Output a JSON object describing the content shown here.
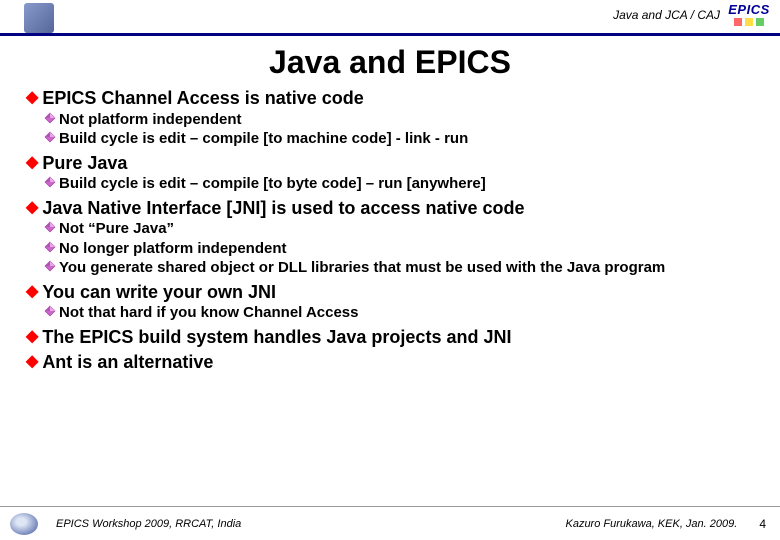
{
  "header": {
    "path": "Java and JCA / CAJ",
    "logo_text": "EPICS"
  },
  "title": "Java and EPICS",
  "bullets": [
    {
      "level": 1,
      "text": "EPICS Channel Access is native code"
    },
    {
      "level": 2,
      "text": "Not platform independent"
    },
    {
      "level": 2,
      "text": "Build cycle is edit – compile [to machine code] - link - run"
    },
    {
      "level": 1,
      "text": "Pure Java"
    },
    {
      "level": 2,
      "text": "Build cycle is edit – compile [to byte code] – run [anywhere]"
    },
    {
      "level": 1,
      "text": "Java Native Interface [JNI] is used to access native code"
    },
    {
      "level": 2,
      "text": "Not “Pure Java”"
    },
    {
      "level": 2,
      "text": "No longer platform independent"
    },
    {
      "level": 2,
      "text": "You generate shared object or DLL libraries that must be used with the Java program"
    },
    {
      "level": 1,
      "text": "You can write your own JNI"
    },
    {
      "level": 2,
      "text": "Not that hard if you know Channel Access"
    },
    {
      "level": 1,
      "text": "The EPICS build system handles Java projects and JNI"
    },
    {
      "level": 1,
      "text": "Ant is an alternative"
    }
  ],
  "footer": {
    "left": "EPICS Workshop 2009, RRCAT, India",
    "right": "Kazuro Furukawa, KEK, Jan. 2009.",
    "page": "4"
  }
}
